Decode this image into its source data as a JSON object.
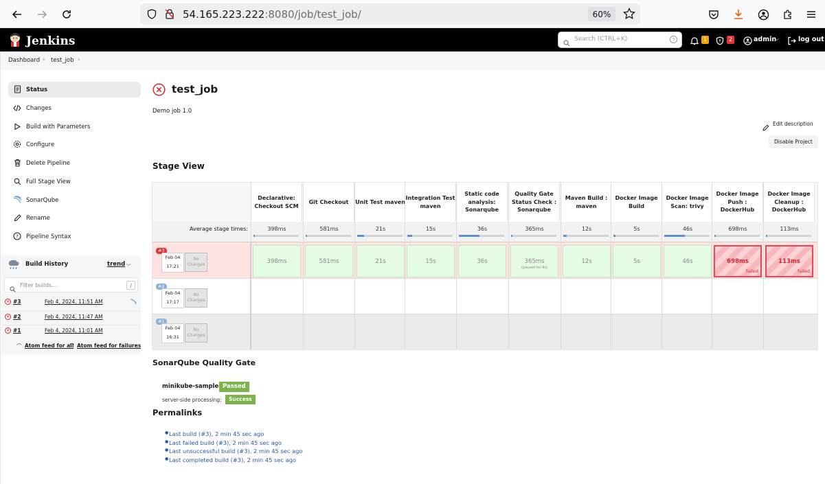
{
  "browser": {
    "url_host": "54.165.223.222",
    "url_rest": ":8080/job/test_job/",
    "zoom": "60%"
  },
  "header": {
    "brand": "Jenkins",
    "search_placeholder": "Search (CTRL+K)",
    "notifications_count": "1",
    "security_count": "2",
    "user": "admin",
    "logout": "log out"
  },
  "breadcrumb": [
    "Dashboard",
    "test_job"
  ],
  "sidebar": {
    "items": [
      {
        "label": "Status",
        "icon": "document-icon",
        "active": true
      },
      {
        "label": "Changes",
        "icon": "code-icon"
      },
      {
        "label": "Build with Parameters",
        "icon": "play-icon"
      },
      {
        "label": "Configure",
        "icon": "gear-icon"
      },
      {
        "label": "Delete Pipeline",
        "icon": "trash-icon"
      },
      {
        "label": "Full Stage View",
        "icon": "search-icon"
      },
      {
        "label": "SonarQube",
        "icon": "sonarqube-icon"
      },
      {
        "label": "Rename",
        "icon": "pencil-icon"
      },
      {
        "label": "Pipeline Syntax",
        "icon": "help-icon"
      }
    ],
    "build_history": {
      "title": "Build History",
      "trend": "trend",
      "filter_placeholder": "Filter builds...",
      "filter_key": "/",
      "builds": [
        {
          "number": "#3",
          "date": "Feb 4, 2024, 11:51 AM"
        },
        {
          "number": "#2",
          "date": "Feb 4, 2024, 11:47 AM"
        },
        {
          "number": "#1",
          "date": "Feb 4, 2024, 11:01 AM"
        }
      ],
      "atom_all": "Atom feed for all",
      "atom_failures": "Atom feed for failures"
    }
  },
  "job": {
    "title": "test_job",
    "description": "Demo job 1.0",
    "edit_description": "Edit description",
    "disable_project": "Disable Project"
  },
  "stage_view": {
    "title": "Stage View",
    "avg_label": "Average stage times:",
    "stages": [
      {
        "name": "Declarative: Checkout SCM",
        "avg": "398ms",
        "bar": 0.02
      },
      {
        "name": "Git Checkout",
        "avg": "581ms",
        "bar": 0.02
      },
      {
        "name": "Unit Test maven",
        "avg": "21s",
        "bar": 0.15
      },
      {
        "name": "Integration Test maven",
        "avg": "15s",
        "bar": 0.1
      },
      {
        "name": "Static code analysis: Sonarqube",
        "avg": "36s",
        "bar": 0.45
      },
      {
        "name": "Quality Gate Status Check : Sonarqube",
        "avg": "365ms",
        "bar": 0.02
      },
      {
        "name": "Maven Build : maven",
        "avg": "12s",
        "bar": 0.08
      },
      {
        "name": "Docker Image Build",
        "avg": "5s",
        "bar": 0.04
      },
      {
        "name": "Docker Image Scan: trivy",
        "avg": "46s",
        "bar": 0.45
      },
      {
        "name": "Docker Image Push : DockerHub",
        "avg": "698ms",
        "bar": 0.02
      },
      {
        "name": "Docker Image Cleanup : DockerHub",
        "avg": "113ms",
        "bar": 0.02
      }
    ],
    "runs": [
      {
        "badge": "#3",
        "date": "Feb 04",
        "time": "17:21",
        "changes": "No Changes",
        "cells": [
          {
            "value": "398ms",
            "status": "ok"
          },
          {
            "value": "581ms",
            "status": "ok"
          },
          {
            "value": "21s",
            "status": "ok"
          },
          {
            "value": "15s",
            "status": "ok"
          },
          {
            "value": "36s",
            "status": "ok"
          },
          {
            "value": "365ms",
            "status": "ok",
            "note": "(paused for 9s)"
          },
          {
            "value": "12s",
            "status": "ok"
          },
          {
            "value": "5s",
            "status": "ok"
          },
          {
            "value": "46s",
            "status": "ok"
          },
          {
            "value": "698ms",
            "status": "failed",
            "note": "failed"
          },
          {
            "value": "113ms",
            "status": "failed",
            "note": "failed"
          }
        ]
      },
      {
        "badge": "#2",
        "date": "Feb 04",
        "time": "17:17",
        "changes": "No Changes",
        "cells": []
      },
      {
        "badge": "#1",
        "date": "Feb 04",
        "time": "16:31",
        "changes": "No Changes",
        "cells": []
      }
    ]
  },
  "sonar": {
    "title": "SonarQube Quality Gate",
    "project": "minikube-sample",
    "status": "Passed",
    "processing_label": "server-side processing:",
    "processing_status": "Success"
  },
  "permalinks": {
    "title": "Permalinks",
    "links": [
      "Last build (#3), 2 min 45 sec ago",
      "Last failed build (#3), 2 min 45 sec ago",
      "Last unsuccessful build (#3), 2 min 45 sec ago",
      "Last completed build (#3), 2 min 45 sec ago"
    ]
  },
  "colors": {
    "failed": "#d8262f",
    "success": "#7bb44b",
    "link": "#2957a4"
  }
}
